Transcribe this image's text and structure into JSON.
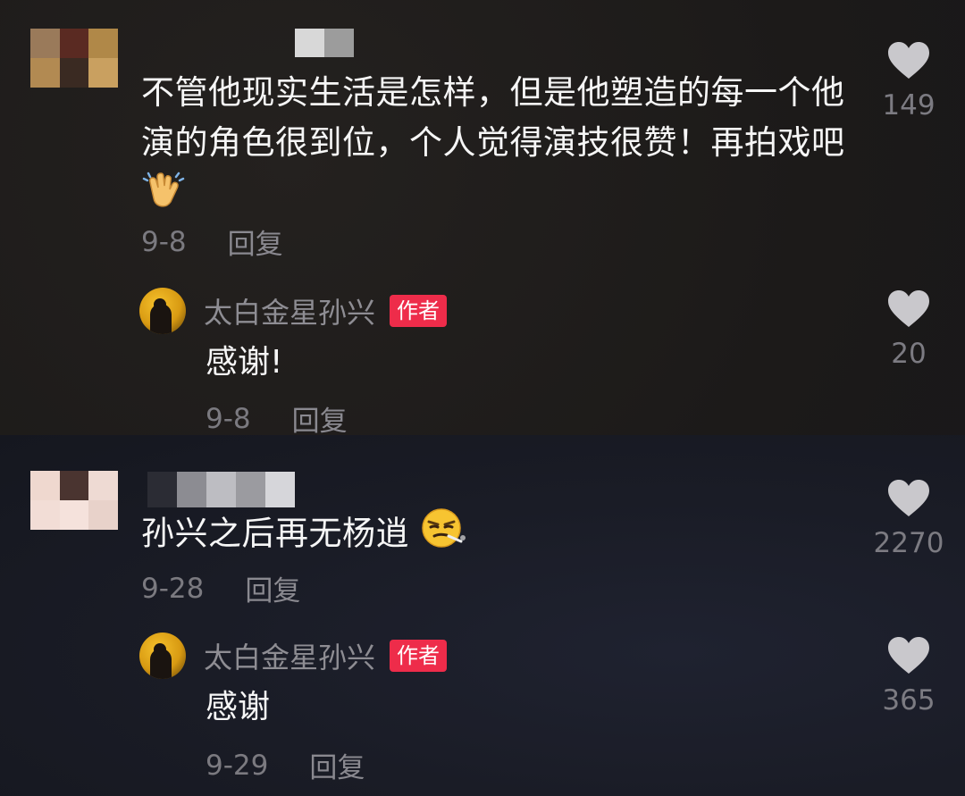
{
  "comments": [
    {
      "text": "不管他现实生活是怎样，但是他塑造的每一个他演的角色很到位，个人觉得演技很赞！再拍戏吧",
      "emoji": "clapping-hands-icon",
      "date": "9-8",
      "reply_label": "回复",
      "likes": "149",
      "reply": {
        "author": "太白金星孙兴",
        "badge": "作者",
        "text": "感谢!",
        "date": "9-8",
        "reply_label": "回复",
        "likes": "20"
      }
    },
    {
      "text": "孙兴之后再无杨逍",
      "emoji": "smug-face-icon",
      "date": "9-28",
      "reply_label": "回复",
      "likes": "2270",
      "reply": {
        "author": "太白金星孙兴",
        "badge": "作者",
        "text": "感谢",
        "date": "9-29",
        "reply_label": "回复",
        "likes": "365"
      }
    }
  ],
  "colors": {
    "background": "#1b1a1f",
    "text": "#f6f6f6",
    "meta": "#7b7a80",
    "badge": "#ee2c4a",
    "heart": "#c9c8cc"
  }
}
